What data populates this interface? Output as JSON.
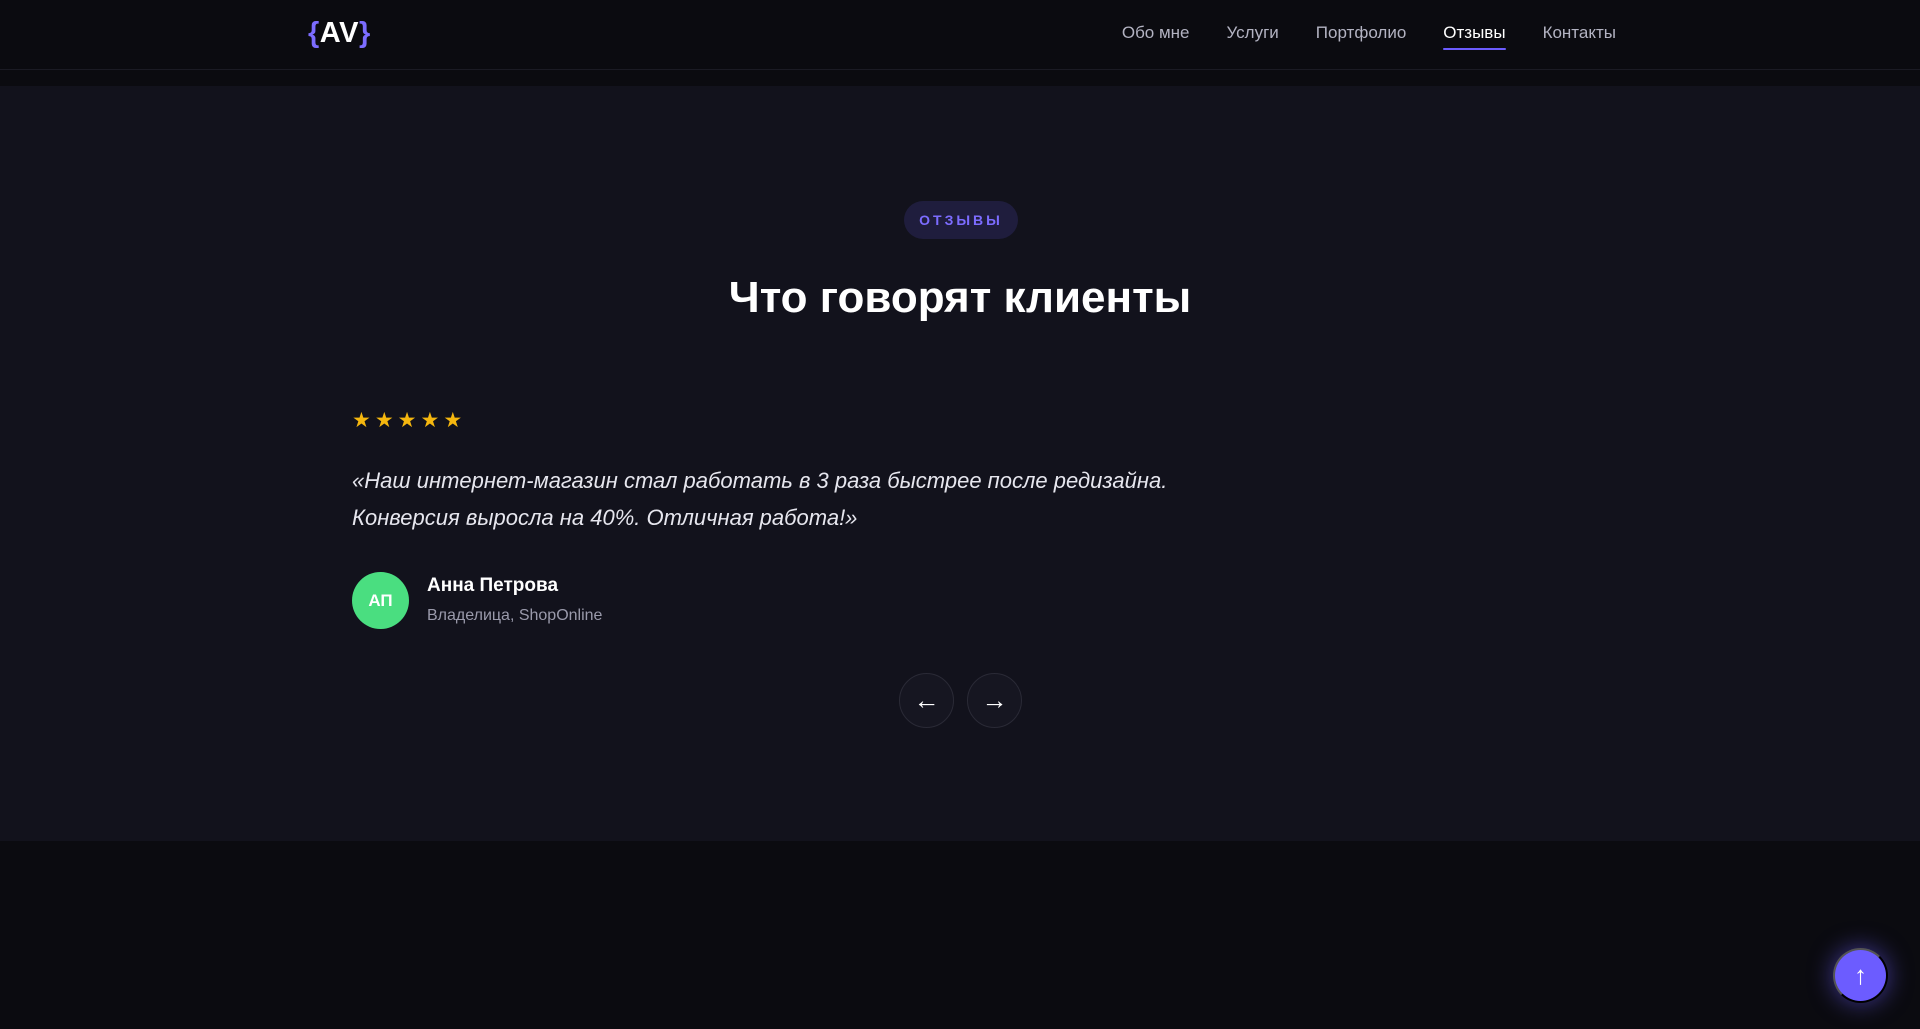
{
  "header": {
    "logo": {
      "open_brace": "{",
      "letters": "AV",
      "close_brace": "}"
    },
    "nav": [
      {
        "label": "Обо мне"
      },
      {
        "label": "Услуги"
      },
      {
        "label": "Портфолио"
      },
      {
        "label": "Отзывы",
        "active": true
      },
      {
        "label": "Контакты"
      }
    ]
  },
  "testimonials": {
    "badge": "ОТЗЫВЫ",
    "title": "Что говорят клиенты",
    "rating": 5,
    "rating_max": 5,
    "star_glyph": "★",
    "quote_line1": "«Наш интернет-магазин стал работать в 3 раза быстрее после редизайна.",
    "quote_line2": "Конверсия выросла на 40%. Отличная работа!»",
    "author": {
      "initials": "АП",
      "name": "Анна Петрова",
      "role": "Владелица, ShopOnline"
    },
    "prev_glyph": "←",
    "next_glyph": "→"
  },
  "scroll_top_glyph": "↑",
  "colors": {
    "accent": "#6c5cff",
    "star": "#f5b70f",
    "avatar": "#4ade80",
    "section_bg": "#12121c",
    "page_bg": "#0b0b10"
  }
}
